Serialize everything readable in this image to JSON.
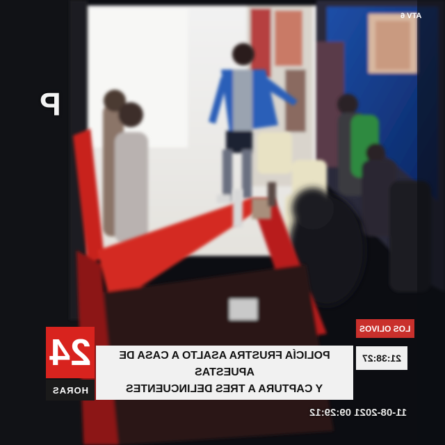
{
  "frame": {
    "description_free": true
  },
  "overlay": {
    "label_box": "LOS OLIVOS",
    "time": "21:38:27",
    "headline_line1": "POLICÍA FRUSTRA ASALTO A CASA DE APUESTAS",
    "headline_line2": "Y CAPTURA A TRES DELINCUENTES",
    "logo_number": "24",
    "logo_sub": "HORAS",
    "timestamp": "11-08-2021 09:29:12",
    "watermark": "P",
    "channel_mark": "ATV 6"
  },
  "colors": {
    "accent_red": "#d8231e",
    "banner_bg": "#f1f1f1",
    "counter_red": "#c8231d"
  }
}
